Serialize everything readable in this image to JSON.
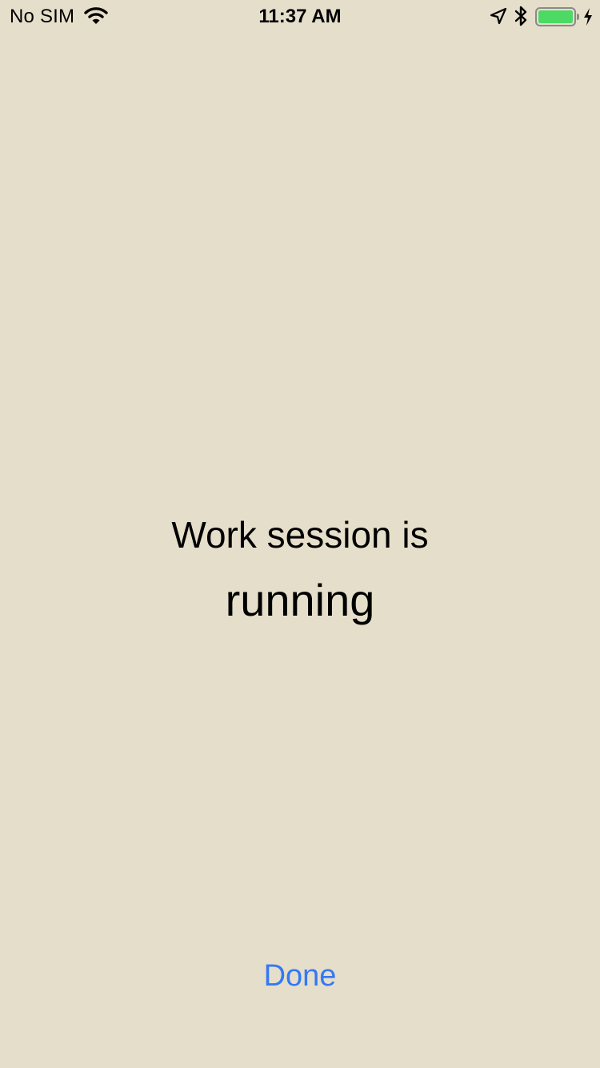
{
  "status_bar": {
    "carrier": "No SIM",
    "time": "11:37 AM",
    "icons": [
      "wifi-icon",
      "location-arrow-icon",
      "bluetooth-icon",
      "battery-icon",
      "charging-bolt-icon"
    ],
    "battery_level": 1.0,
    "battery_color": "#4cd964"
  },
  "main": {
    "headline": "Work session is",
    "state": "running"
  },
  "actions": {
    "done_label": "Done",
    "accent_color": "#3478f6"
  },
  "background_color": "#e5deca"
}
